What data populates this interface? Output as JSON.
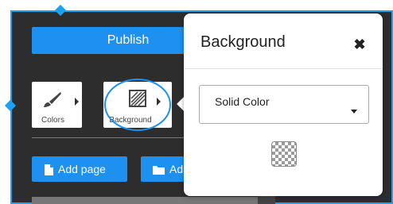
{
  "editor": {
    "publish_label": "Publish",
    "tools": [
      {
        "label": "Colors",
        "icon": "paintbrush-icon"
      },
      {
        "label": "Background",
        "icon": "background-pattern-icon"
      }
    ],
    "actions": [
      {
        "label": "Add page",
        "icon": "file-icon"
      },
      {
        "label": "Ad",
        "icon": "folder-icon"
      }
    ],
    "accent_color": "#1e90f0"
  },
  "popover": {
    "title": "Background",
    "close_glyph": "✖",
    "fill_type": {
      "selected": "Solid Color"
    },
    "swatch": "transparent-swatch"
  }
}
